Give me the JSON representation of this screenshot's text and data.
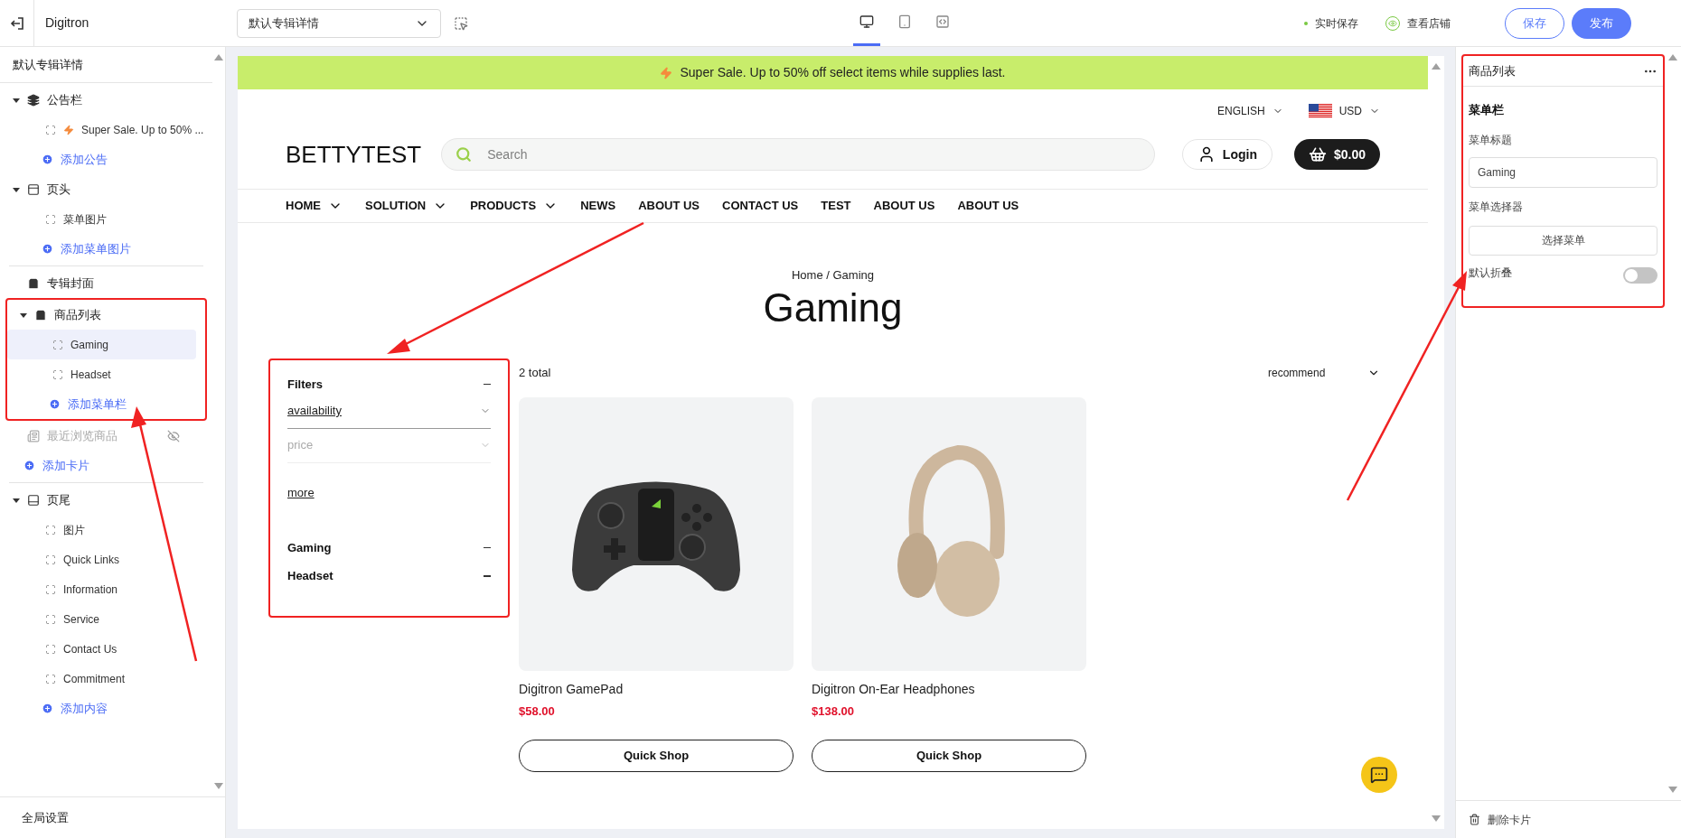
{
  "topbar": {
    "site_name": "Digitron",
    "page_select": {
      "value": "默认专辑详情"
    },
    "devices": [
      {
        "kind": "desktop",
        "selected": true
      },
      {
        "kind": "tablet",
        "selected": false
      },
      {
        "kind": "code",
        "selected": false
      }
    ],
    "autosave": "实时保存",
    "view_store": "查看店铺",
    "buttons": [
      {
        "label": "保存",
        "kind": "outline"
      },
      {
        "label": "发布",
        "kind": "primary"
      }
    ]
  },
  "sidebar": {
    "title": "默认专辑详情",
    "blocks": [
      {
        "kind": "group",
        "label": "公告栏",
        "expanded": true,
        "items": [
          {
            "label": "Super Sale. Up to 50% ...",
            "bolt": true,
            "selected": false
          }
        ],
        "add": "添加公告"
      },
      {
        "kind": "group",
        "label": "页头",
        "expanded": true,
        "items": [
          {
            "label": "菜单图片",
            "selected": false
          }
        ],
        "add": "添加菜单图片"
      },
      {
        "kind": "card",
        "label": "专辑封面",
        "divider_before": true,
        "hidden": false
      },
      {
        "kind": "group",
        "label": "商品列表",
        "expanded": true,
        "highlighted": true,
        "items": [
          {
            "label": "Gaming",
            "selected": true
          },
          {
            "label": "Headset",
            "selected": false
          }
        ],
        "add": "添加菜单栏"
      },
      {
        "kind": "card",
        "label": "最近浏览商品",
        "hidden": true
      },
      {
        "kind": "add",
        "label": "添加卡片"
      },
      {
        "kind": "group",
        "label": "页尾",
        "expanded": true,
        "divider_before": true,
        "items": [
          {
            "label": "图片",
            "selected": false
          },
          {
            "label": "Quick Links",
            "selected": false
          },
          {
            "label": "Information",
            "selected": false
          },
          {
            "label": "Service",
            "selected": false
          },
          {
            "label": "Contact Us",
            "selected": false
          },
          {
            "label": "Commitment",
            "selected": false
          }
        ],
        "add": "添加内容"
      }
    ],
    "footer": "全局设置"
  },
  "preview": {
    "announcement": "Super Sale. Up to 50% off select items while supplies last.",
    "language": "ENGLISH",
    "currency": "USD",
    "logo": "BETTYTEST",
    "search": {
      "placeholder": "Search"
    },
    "login": "Login",
    "cart": "$0.00",
    "nav": [
      {
        "label": "HOME",
        "dropdown": true
      },
      {
        "label": "SOLUTION",
        "dropdown": true
      },
      {
        "label": "PRODUCTS",
        "dropdown": true
      },
      {
        "label": "NEWS",
        "dropdown": false
      },
      {
        "label": "ABOUT US",
        "dropdown": false
      },
      {
        "label": "CONTACT US",
        "dropdown": false
      },
      {
        "label": "TEST",
        "dropdown": false
      },
      {
        "label": "ABOUT US",
        "dropdown": false
      },
      {
        "label": "ABOUT US",
        "dropdown": false
      }
    ],
    "breadcrumb": "Home / Gaming",
    "title": "Gaming",
    "filters": {
      "title": "Filters",
      "highlighted": true,
      "facets": [
        {
          "label": "availability",
          "active": true
        },
        {
          "label": "price",
          "active": false
        }
      ],
      "more": "more",
      "categories": [
        "Gaming",
        "Headset"
      ]
    },
    "total": "2 total",
    "sort": "recommend",
    "products": [
      {
        "kind": "gamepad",
        "name": "Digitron GamePad",
        "price": "$58.00",
        "button": "Quick Shop"
      },
      {
        "kind": "headphones",
        "name": "Digitron On-Ear Headphones",
        "price": "$138.00",
        "button": "Quick Shop"
      }
    ]
  },
  "editor": {
    "title": "商品列表",
    "highlighted": true,
    "section": "菜单栏",
    "title_label": "菜单标题",
    "title_value": "Gaming",
    "selector_label": "菜单选择器",
    "selector_button": "选择菜单",
    "collapse_label": "默认折叠",
    "collapse_on": false,
    "delete": "删除卡片"
  }
}
